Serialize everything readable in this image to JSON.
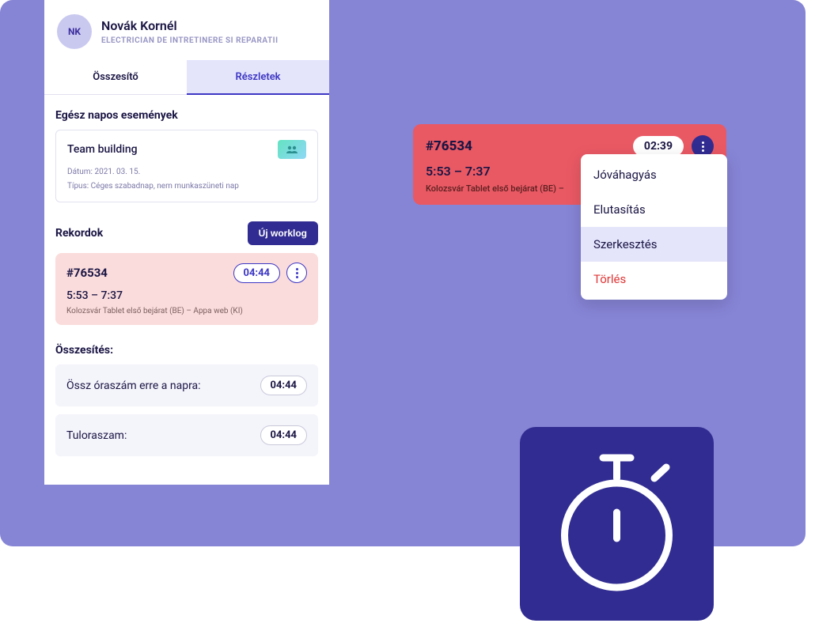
{
  "user": {
    "initials": "NK",
    "name": "Novák Kornél",
    "role": "ELECTRICIAN DE INTRETINERE SI REPARATII"
  },
  "tabs": {
    "summary": "Összesítő",
    "details": "Részletek"
  },
  "events": {
    "heading": "Egész napos események",
    "card": {
      "title": "Team building",
      "date_line": "Dátum: 2021. 03. 15.",
      "type_line": "Típus: Céges szabadnap, nem munkaszüneti nap"
    }
  },
  "records": {
    "heading": "Rekordok",
    "new_button": "Új worklog",
    "item": {
      "id": "#76534",
      "duration": "04:44",
      "times": "5:53 – 7:37",
      "location": "Kolozsvár Tablet első bejárat (BE) – Appa web (KI)"
    }
  },
  "summary": {
    "heading": "Összesítés:",
    "rows": [
      {
        "label": "Össz óraszám erre a napra:",
        "value": "04:44"
      },
      {
        "label": "Tuloraszam:",
        "value": "04:44"
      }
    ]
  },
  "popup": {
    "id": "#76534",
    "duration": "02:39",
    "times": "5:53 – 7:37",
    "location": "Kolozsvár Tablet első bejárat (BE) –"
  },
  "menu": {
    "approve": "Jóváhagyás",
    "reject": "Elutasítás",
    "edit": "Szerkesztés",
    "delete": "Törlés"
  }
}
